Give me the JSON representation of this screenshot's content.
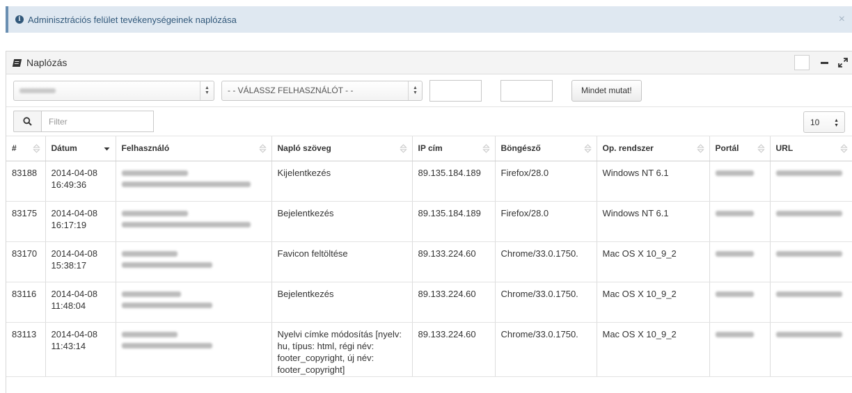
{
  "alert": {
    "message": "Adminisztrációs felület tevékenységeinek naplózása",
    "close": "×"
  },
  "panel": {
    "title": "Naplózás"
  },
  "filters": {
    "user_select": "- - VÁLASSZ FELHASZNÁLÓT - -",
    "show_all": "Mindet mutat!"
  },
  "search": {
    "placeholder": "Filter",
    "page_size": "10"
  },
  "table": {
    "columns": [
      "#",
      "Dátum",
      "Felhasználó",
      "Napló szöveg",
      "IP cím",
      "Böngésző",
      "Op. rendszer",
      "Portál",
      "URL"
    ],
    "rows": [
      {
        "id": "83188",
        "date": "2014-04-08",
        "time": "16:49:36",
        "text": "Kijelentkezés",
        "ip": "89.135.184.189",
        "browser": "Firefox/28.0",
        "os": "Windows NT 6.1"
      },
      {
        "id": "83175",
        "date": "2014-04-08",
        "time": "16:17:19",
        "text": "Bejelentkezés",
        "ip": "89.135.184.189",
        "browser": "Firefox/28.0",
        "os": "Windows NT 6.1"
      },
      {
        "id": "83170",
        "date": "2014-04-08",
        "time": "15:38:17",
        "text": "Favicon feltöltése",
        "ip": "89.133.224.60",
        "browser": "Chrome/33.0.1750.",
        "os": "Mac OS X 10_9_2"
      },
      {
        "id": "83116",
        "date": "2014-04-08",
        "time": "11:48:04",
        "text": "Bejelentkezés",
        "ip": "89.133.224.60",
        "browser": "Chrome/33.0.1750.",
        "os": "Mac OS X 10_9_2"
      },
      {
        "id": "83113",
        "date": "2014-04-08",
        "time": "11:43:14",
        "text": "Nyelvi címke módosítás [nyelv: hu, típus: html, régi név: footer_copyright, új név: footer_copyright]",
        "ip": "89.133.224.60",
        "browser": "Chrome/33.0.1750.",
        "os": "Mac OS X 10_9_2"
      }
    ]
  }
}
